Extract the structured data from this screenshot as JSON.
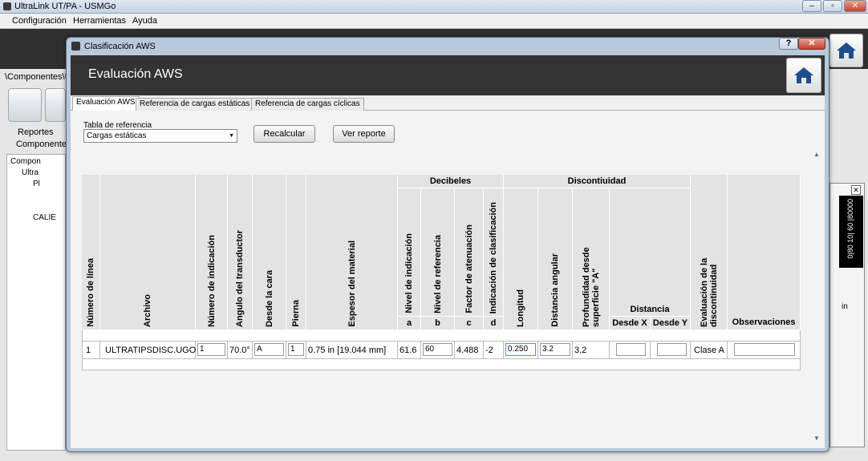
{
  "app": {
    "title": "UltraLink UT/PA - USMGo",
    "menu": [
      "Configuración",
      "Herramientas",
      "Ayuda"
    ],
    "window_controls": [
      "–",
      "▫",
      "✕"
    ]
  },
  "background": {
    "breadcrumb": "\\Componentes\\Ul",
    "tabs": [
      "Reportes",
      "Componentes"
    ],
    "tree": [
      "Compon",
      "Ultra",
      "Pl",
      "CALIE"
    ]
  },
  "dialog": {
    "title": "Clasificación AWS",
    "help": "?",
    "close": "✕",
    "heading": "Evaluación AWS",
    "tabs": [
      "Evaluación AWS",
      "Referencia de cargas estáticas",
      "Referencia de cargas cíclicas"
    ],
    "reference_label": "Tabla de referencia",
    "reference_value": "Cargas estáticas",
    "recalc_button": "Recalcular",
    "report_button": "Ver reporte"
  },
  "table": {
    "group_headers": {
      "decibels": "Decibeles",
      "discontinuity": "Discontiuidad",
      "distance": "Distancia"
    },
    "headers": {
      "line": "Número de línea",
      "file": "Archivo",
      "indication": "Número de indicación",
      "angle": "Angulo del transductor",
      "face": "Desde la cara",
      "leg": "Pierna",
      "thickness": "Espesor del material",
      "ind_level": "Nivel de indicación",
      "ref_level": "Nivel de referencia",
      "atten": "Factor de atenuación",
      "class_ind": "Indicación de clasificación",
      "length": "Longitud",
      "ang_dist": "Distancia angular",
      "depth": "Profundidad desde superficie \"A\"",
      "from_x": "Desde X",
      "from_y": "Desde Y",
      "eval": "Evaluación de la discontinuidad",
      "obs": "Observaciones"
    },
    "letters": {
      "a": "a",
      "b": "b",
      "c": "c",
      "d": "d"
    },
    "row": {
      "line": "1",
      "file": "ULTRATIPSDISC.UGO",
      "indication": "1",
      "angle": "70.0°",
      "face": "A",
      "leg": "1",
      "thickness": "0.75 in [19.044 mm]",
      "ind_level": "61.6",
      "ref_level": "60",
      "atten": "4.488",
      "class_ind": "-2",
      "length": "0.250",
      "ang_dist": "3.2",
      "depth": "3.2",
      "from_x": "",
      "from_y": "",
      "eval": "Clase A",
      "obs": ""
    }
  },
  "side_panel": {
    "ruler_text": "0|80 10| 60 |80000",
    "unit": "in"
  }
}
